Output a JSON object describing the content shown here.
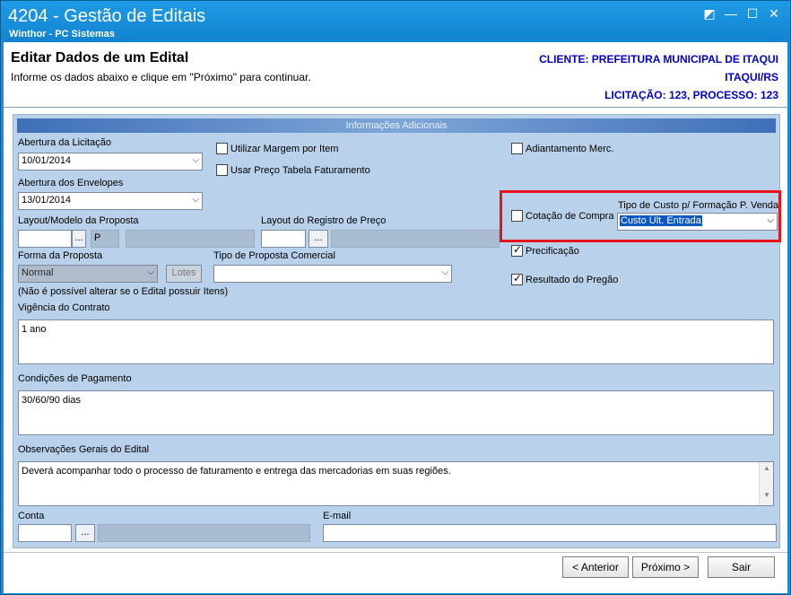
{
  "window": {
    "title": "4204 - Gestão de Editais",
    "subtitle": "Winthor - PC Sistemas",
    "controls": [
      "◩",
      "—",
      "☐",
      "✕"
    ]
  },
  "header": {
    "title": "Editar Dados de um Edital",
    "subtitle": "Informe os dados abaixo e clique em \"Próximo\" para continuar.",
    "client": "CLIENTE: PREFEITURA MUNICIPAL DE ITAQUI",
    "city": "ITAQUI/RS",
    "bid": "LICITAÇÃO: 123, PROCESSO: 123"
  },
  "section": {
    "title": "Informações Adicionais"
  },
  "form": {
    "abertura_licitacao_label": "Abertura da Licitação",
    "abertura_licitacao_value": "10/01/2014",
    "abertura_envelopes_label": "Abertura dos Envelopes",
    "abertura_envelopes_value": "13/01/2014",
    "utilizar_margem_label": "Utilizar Margem por Item",
    "usar_preco_label": "Usar Preço Tabela Faturamento",
    "adiantamento_label": "Adiantamento Merc.",
    "layout_modelo_label": "Layout/Modelo da Proposta",
    "layout_modelo_p": "P",
    "layout_registro_label": "Layout do Registro de Preço",
    "ellipsis": "...",
    "cotacao_label": "Cotação de Compra",
    "tipo_custo_label": "Tipo de Custo p/ Formação P. Venda",
    "tipo_custo_value": "Custo Últ. Entrada",
    "forma_proposta_label": "Forma da Proposta",
    "forma_proposta_value": "Normal",
    "lotes_label": "Lotes",
    "tipo_proposta_label": "Tipo de Proposta Comercial",
    "nao_possivel_note": "(Não é possível alterar se o Edital possuir Itens)",
    "precificacao_label": "Precificação",
    "resultado_label": "Resultado do Pregão",
    "vigencia_label": "Vigência do Contrato",
    "vigencia_value": "1 ano",
    "condicoes_label": "Condições de Pagamento",
    "condicoes_value": "30/60/90 dias",
    "observacoes_label": "Observações Gerais do Edital",
    "observacoes_value": "Deverá acompanhar todo o processo de faturamento e entrega das mercadorias em suas regiões.",
    "conta_label": "Conta",
    "email_label": "E-mail"
  },
  "buttons": {
    "anterior": "< Anterior",
    "proximo": "Próximo >",
    "sair": "Sair"
  },
  "colors": {
    "titlebar": "#1d8ed8",
    "form_panel": "#b9d1ea",
    "highlight_box": "#e8121a",
    "header_info": "#0000cc"
  }
}
